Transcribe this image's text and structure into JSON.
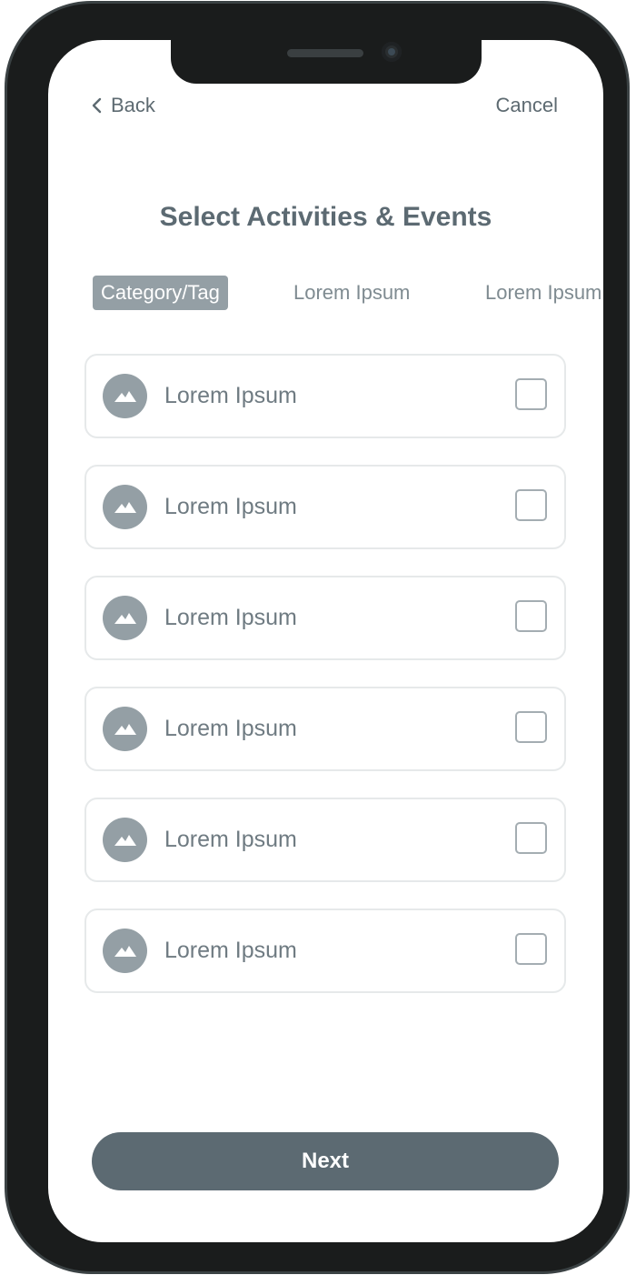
{
  "nav": {
    "back_label": "Back",
    "cancel_label": "Cancel"
  },
  "page": {
    "title": "Select Activities & Events"
  },
  "tabs": [
    {
      "label": "Category/Tag",
      "active": true
    },
    {
      "label": "Lorem Ipsum",
      "active": false
    },
    {
      "label": "Lorem Ipsum",
      "active": false
    }
  ],
  "items": [
    {
      "label": "Lorem Ipsum",
      "icon": "image-icon",
      "checked": false
    },
    {
      "label": "Lorem Ipsum",
      "icon": "image-icon",
      "checked": false
    },
    {
      "label": "Lorem Ipsum",
      "icon": "image-icon",
      "checked": false
    },
    {
      "label": "Lorem Ipsum",
      "icon": "image-icon",
      "checked": false
    },
    {
      "label": "Lorem Ipsum",
      "icon": "image-icon",
      "checked": false
    },
    {
      "label": "Lorem Ipsum",
      "icon": "image-icon",
      "checked": false
    }
  ],
  "actions": {
    "next_label": "Next"
  },
  "colors": {
    "primary": "#5c6a72",
    "tab_active_bg": "#949fa5",
    "text_muted": "#6f7b82",
    "border": "#e6e9ea",
    "frame": "#1a1c1c"
  }
}
